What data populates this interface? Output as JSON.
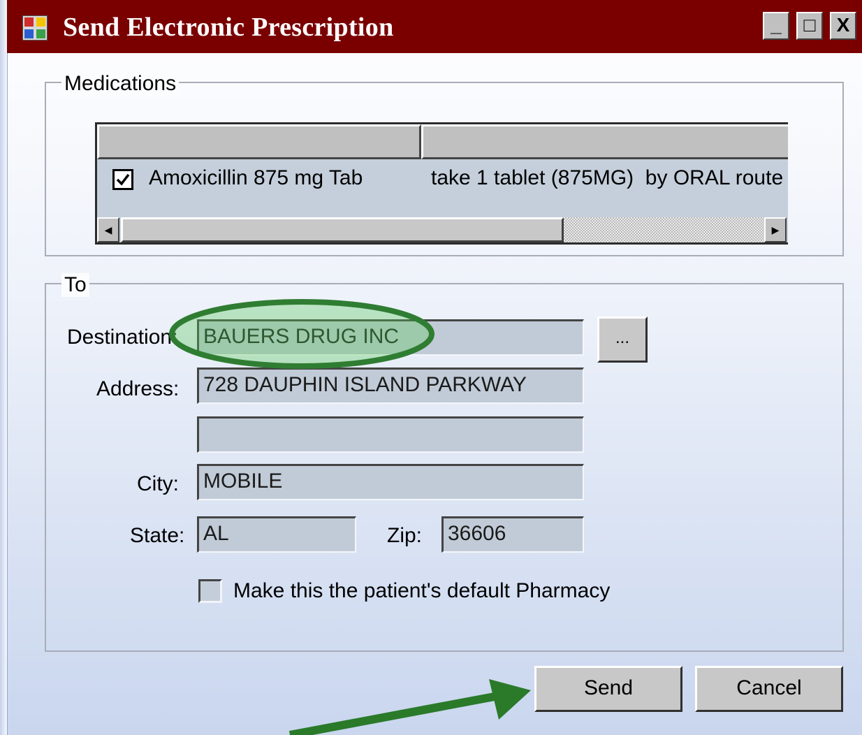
{
  "window": {
    "title": "Send Electronic Prescription",
    "controls": {
      "minimize": "_",
      "maximize": "□",
      "close": "X"
    }
  },
  "medications": {
    "group_label": "Medications",
    "columns": [
      "",
      ""
    ],
    "rows": [
      {
        "checked": true,
        "name": "Amoxicillin 875 mg Tab",
        "instructions": "take 1 tablet (875MG)  by ORAL route"
      }
    ]
  },
  "to": {
    "group_label": "To",
    "destination_label": "Destination:",
    "destination_value": "BAUERS DRUG INC",
    "browse_label": "...",
    "address_label": "Address:",
    "address_line1": "728 DAUPHIN ISLAND PARKWAY",
    "address_line2": "",
    "city_label": "City:",
    "city_value": "MOBILE",
    "state_label": "State:",
    "state_value": "AL",
    "zip_label": "Zip:",
    "zip_value": "36606",
    "default_pharmacy_label": "Make this the patient's default Pharmacy",
    "default_pharmacy_checked": false
  },
  "actions": {
    "send_label": "Send",
    "cancel_label": "Cancel"
  },
  "annotations": {
    "highlight_color": "#2f7d32",
    "arrow_color": "#2a7a2a"
  },
  "colors": {
    "titlebar": "#7a0000",
    "field_bg": "#c1cbd7"
  }
}
